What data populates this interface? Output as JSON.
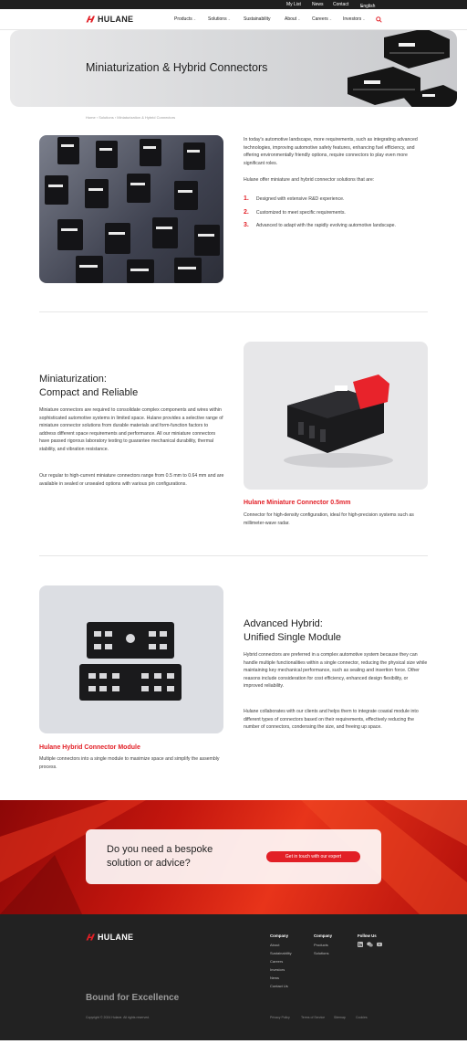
{
  "topbar": {
    "mylist": "My List",
    "news": "News",
    "contact": "Contact",
    "language": "English"
  },
  "brand": {
    "name": "HULANE",
    "accent": "#e21f26"
  },
  "nav": {
    "products": "Products",
    "solutions": "Solutions",
    "sustainability": "Sustainability",
    "about": "About",
    "careers": "Careers",
    "investors": "Investors"
  },
  "hero": {
    "title": "Miniaturization & Hybrid Connectors"
  },
  "breadcrumb": {
    "home": "Home",
    "solutions": "Solutions",
    "current": "Miniaturization & Hybrid Connectors"
  },
  "intro": {
    "paragraph": "In today's automotive landscape, more requirements, such as integrating advanced technologies, improving automotive safety features, enhancing fuel efficiency, and offering environmentally friendly options, require connectors to play even more significant roles.",
    "lead": "Hulane offer miniature and hybrid connector solutions that are:",
    "items": [
      {
        "num": "1.",
        "text": "Designed with extensive R&D experience."
      },
      {
        "num": "2.",
        "text": "Customized to meet specific requirements."
      },
      {
        "num": "3.",
        "text": "Advanced to adapt with the rapidly evolving automotive landscape."
      }
    ]
  },
  "miniaturization": {
    "title_line1": "Miniaturization:",
    "title_line2": "Compact and Reliable",
    "p1": "Miniature connectors are required to consolidate complex components and wires within sophisticated automotive systems in limited space. Hulane provides a selective range of miniature connector solutions from durable materials and form-function factors to address different space requirements and performance. All our miniature connectors have passed rigorous laboratory testing to guarantee mechanical durability, thermal stability, and vibration resistance.",
    "p2": "Our regular to high-current miniature connectors range from 0.5 mm to 0.64 mm and are available in sealed or unsealed options with various pin configurations.",
    "product_title": "Hulane Miniature Connector 0.5mm",
    "product_desc": "Connector for high-density configuration, ideal for high-precision systems such as millimeter-wave radar."
  },
  "hybrid": {
    "title_line1": "Advanced Hybrid:",
    "title_line2": "Unified Single Module",
    "p1": "Hybrid connectors are preferred in a complex automotive system because they can handle multiple functionalities within a single connector, reducing the physical size while maintaining key mechanical performance, such as sealing and insertion force. Other reasons include consideration for cost efficiency, enhanced design flexibility, or improved reliability.",
    "p2": "Hulane collaborates with our clients and helps them to integrate coaxial module into different types of connectors based on their requirements, effectively reducing the number of connectors, condensing the size, and freeing up space.",
    "product_title": "Hulane Hybrid Connector Module",
    "product_desc": "Multiple connectors into a single module to maximize space and simplify the assembly process."
  },
  "cta": {
    "line1": "Do you need a bespoke",
    "line2": "solution or advice?",
    "button": "Get in touch with our expert"
  },
  "footer": {
    "tagline": "Bound for Excellence",
    "company_head": "Company",
    "company_links": [
      "About",
      "Sustainability",
      "Careers",
      "Investors",
      "News",
      "Contact Us"
    ],
    "company2_head": "Company",
    "company2_links": [
      "Products",
      "Solutions"
    ],
    "follow_head": "Follow Us",
    "copyright": "Copyright © 2024 Hulane. All rights reserved.",
    "privacy": "Privacy Policy",
    "terms": "Terms of Service",
    "sitemap": "Sitemap",
    "cookies": "Cookies"
  }
}
